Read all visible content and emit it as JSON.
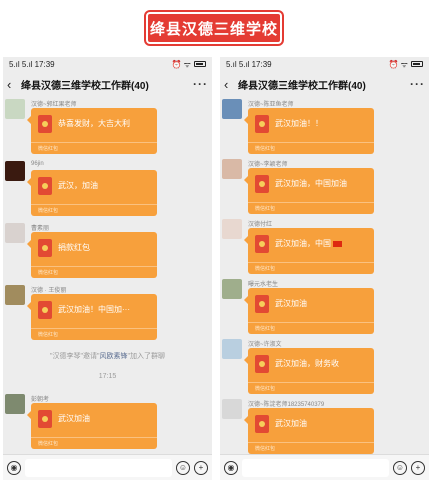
{
  "banner": {
    "text": "绛县汉德三维学校"
  },
  "phones": [
    {
      "status": {
        "signal": "5.ıl 5.ıl",
        "time": "17:39",
        "icons": "⏰ ᯤ"
      },
      "title": "绛县汉德三维学校工作群(40)",
      "messages": [
        {
          "sender": "汉德~郭红果老师",
          "wish": "恭喜发财，大吉大利",
          "footer": "微信红包",
          "avatar": "#c9d8c2"
        },
        {
          "sender": "96jin",
          "wish": "武汉，加油",
          "footer": "微信红包",
          "avatar": "#3a1a10"
        },
        {
          "sender": "曹素丽",
          "wish": "捐款红包",
          "footer": "微信红包",
          "avatar": "#d9d2cf"
        },
        {
          "sender": "汉德 · 王俊丽",
          "wish": "武汉加油！中国加···",
          "footer": "微信红包",
          "avatar": "#a18c5e"
        },
        {
          "sender": "彭朝考",
          "wish": "武汉加油",
          "footer": "微信红包",
          "avatar": "#7e8a6f"
        }
      ],
      "system_note": {
        "part1": "\"汉德李琴\"邀请\"",
        "part2": "风欧素锋",
        "part3": "\"加入了群聊"
      },
      "time_note": "17:15"
    },
    {
      "status": {
        "signal": "5.ıl 5.ıl",
        "time": "17:39",
        "icons": "⏰ ᯤ"
      },
      "title": "绛县汉德三维学校工作群(40)",
      "messages": [
        {
          "sender": "汉德~陈亚鱼老师",
          "wish": "武汉加油！！",
          "footer": "微信红包",
          "avatar": "#6a8fb8"
        },
        {
          "sender": "汉德~李颖老师",
          "wish": "武汉加油，中国加油",
          "footer": "微信红包",
          "avatar": "#d9b9a6"
        },
        {
          "sender": "汉德付红",
          "wish": "武汉加油，中国",
          "footer": "微信红包",
          "avatar": "#e8d8d0"
        },
        {
          "sender": "曝元水老生",
          "wish": "武汉加油",
          "footer": "微信红包",
          "avatar": "#9fae8c"
        },
        {
          "sender": "汉德~许淑文",
          "wish": "武汉加油，财务收",
          "footer": "微信红包",
          "avatar": "#b9cfe0"
        },
        {
          "sender": "汉德~陈淀老师18235740379",
          "wish": "武汉加油",
          "footer": "微信红包",
          "avatar": "#d8d8d8"
        }
      ]
    }
  ],
  "colors": {
    "packet": "#f7a03c",
    "banner": "#e43b33",
    "chat_bg": "#ededed"
  },
  "icons": {
    "back": "back-arrow-icon",
    "more": "more-icon",
    "voice": "voice-icon",
    "emoji": "emoji-icon",
    "plus": "plus-icon",
    "envelope": "red-envelope-icon"
  }
}
